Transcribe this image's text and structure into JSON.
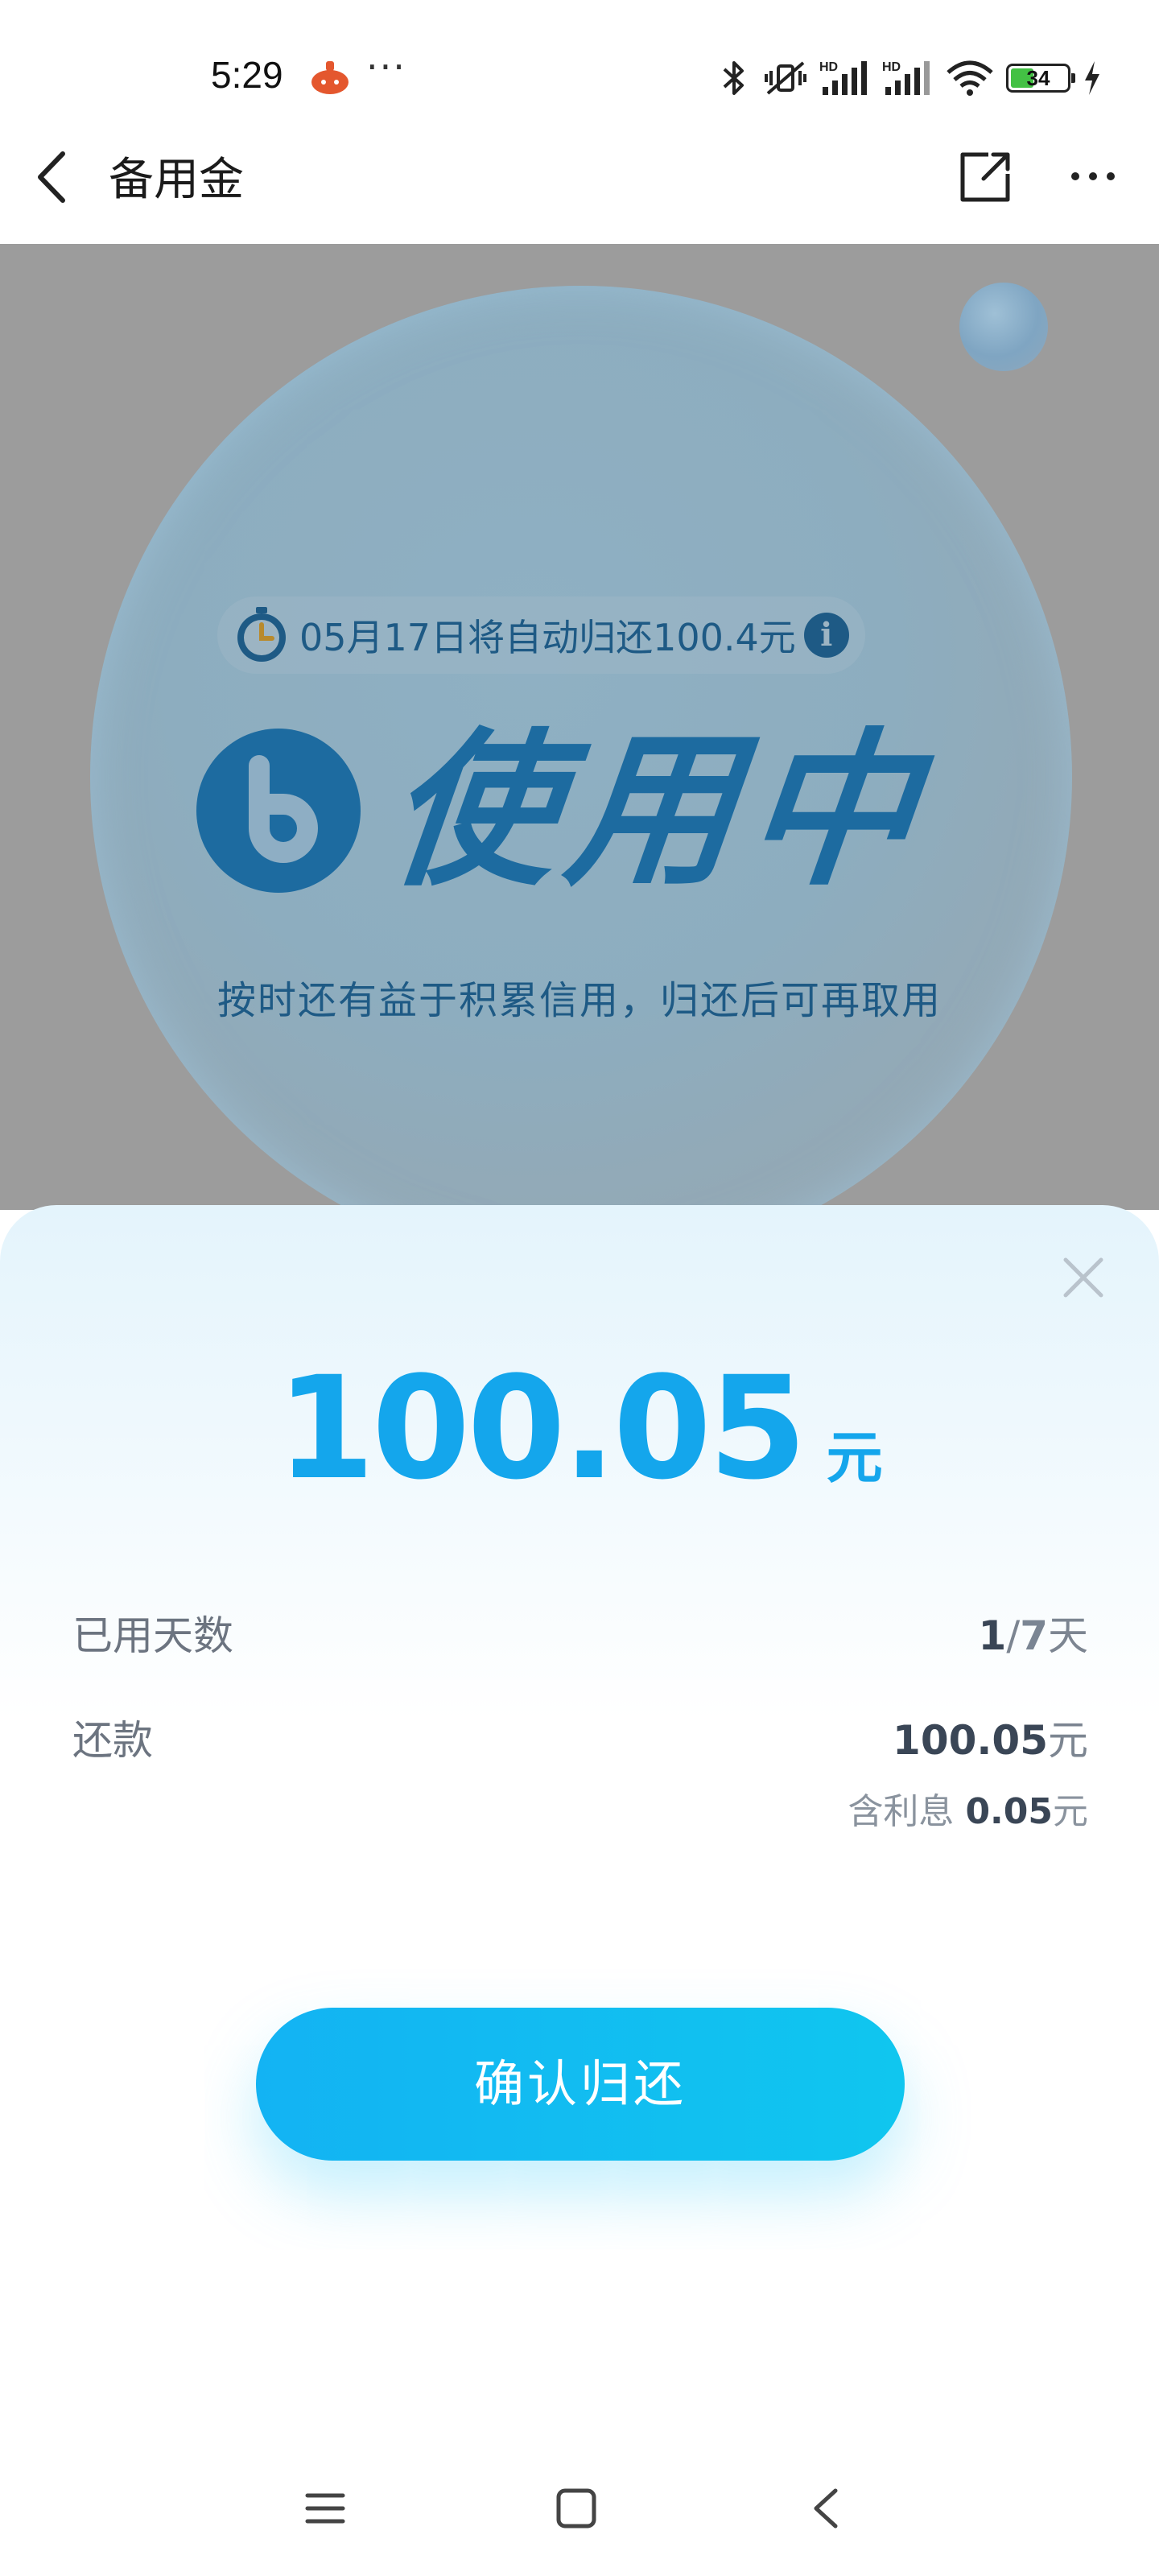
{
  "status_bar": {
    "time": "5:29",
    "dots": "···",
    "battery_level": "34",
    "icons": [
      "app-notification-icon",
      "bluetooth-icon",
      "mute-vibrate-icon",
      "hd-signal-icon",
      "hd-signal-icon",
      "wifi-icon",
      "battery-icon",
      "charging-icon"
    ]
  },
  "nav": {
    "title": "备用金",
    "icons": [
      "back-chevron-icon",
      "share-icon",
      "more-icon"
    ]
  },
  "hero": {
    "notice": "05月17日将自动归还100.4元",
    "status": "使用中",
    "subtitle": "按时还有益于积累信用，归还后可再取用"
  },
  "sheet": {
    "amount": "100.05",
    "amount_unit": "元",
    "rows": {
      "days_label": "已用天数",
      "days_used": "1",
      "days_sep": "/",
      "days_total": "7",
      "days_unit": "天",
      "repay_label": "还款",
      "repay_amount": "100.05",
      "repay_unit": "元",
      "interest_label": "含利息",
      "interest_amount": "0.05",
      "interest_unit": "元"
    },
    "confirm_button": "确认归还"
  },
  "colors": {
    "accent": "#14a6ec",
    "button_start": "#13b3f3",
    "button_end": "#10c6ef",
    "hero_dim": "#9c9c9c",
    "hero_text": "#1d6ba0"
  }
}
